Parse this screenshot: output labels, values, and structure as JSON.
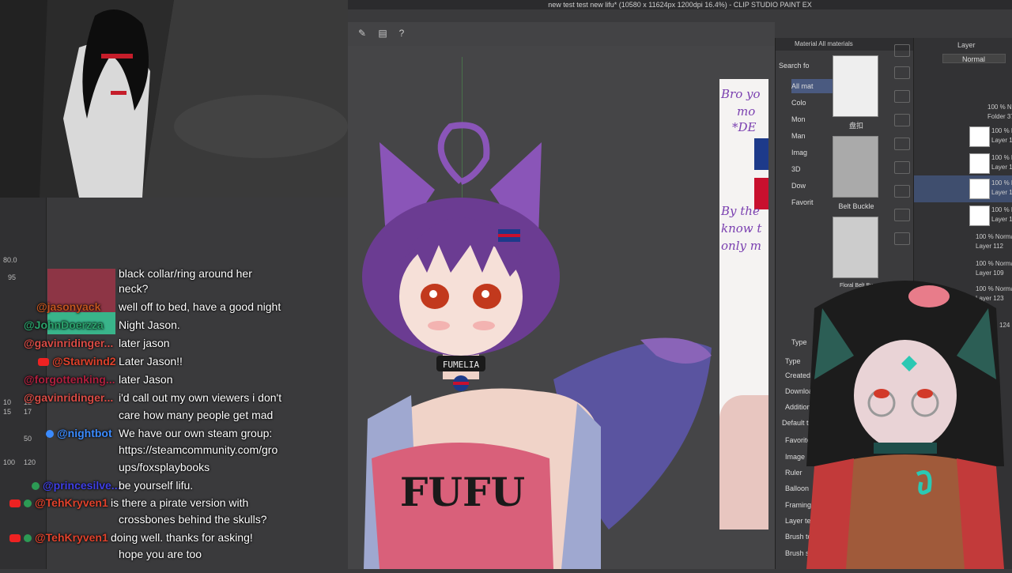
{
  "window": {
    "title": "new test test new lifu* (10580 x 11624px 1200dpi 16.4%) - CLIP STUDIO PAINT EX"
  },
  "left_panel": {
    "brush_size": "80.0",
    "opacity": "95",
    "size_presets": [
      "10",
      "12",
      "15",
      "17",
      "50",
      "100",
      "120"
    ]
  },
  "chat": {
    "messages": [
      {
        "user": "",
        "text": "black collar/ring around her",
        "user_color": "#ffffff"
      },
      {
        "user": "",
        "text": "neck?",
        "user_color": "#ffffff"
      },
      {
        "user": "@jasonyack",
        "text": "well off to bed, have a good night",
        "user_color": "#c2551f"
      },
      {
        "user": "@JohnDoerzza",
        "text": "Night Jason.",
        "user_color": "#2aa36b"
      },
      {
        "user": "@gavinridinger...",
        "text": "later jason",
        "user_color": "#d94b45"
      },
      {
        "user": "@Starwind2",
        "text": "Later Jason!!",
        "user_color": "#e0422c"
      },
      {
        "user": "@forgottenking...",
        "text": "later Jason",
        "user_color": "#b01f3e"
      },
      {
        "user": "@gavinridinger...",
        "text": "i'd call out my own viewers i don't",
        "user_color": "#d94b45"
      },
      {
        "user": "",
        "text": "care how many people get mad",
        "user_color": "#ffffff"
      },
      {
        "user": "@nightbot",
        "text": "We have our own steam group:",
        "user_color": "#3b8bff"
      },
      {
        "user": "",
        "text": "https://steamcommunity.com/gro",
        "user_color": "#ffffff"
      },
      {
        "user": "",
        "text": "ups/foxsplaybooks",
        "user_color": "#ffffff"
      },
      {
        "user": "@princesilve...",
        "text": "be yourself lifu.",
        "user_color": "#3f3fe6"
      },
      {
        "user": "@TehKryven1",
        "text": "is there a pirate version with",
        "user_color": "#e0422c"
      },
      {
        "user": "",
        "text": "crossbones behind the skulls?",
        "user_color": "#ffffff"
      },
      {
        "user": "@TehKryven1",
        "text": "doing well. thanks for asking!",
        "user_color": "#e0422c"
      },
      {
        "user": "",
        "text": "hope you are too",
        "user_color": "#ffffff"
      }
    ]
  },
  "materials": {
    "header": "Material  All materials",
    "search_label": "Search fo",
    "tree": [
      "All mat",
      "Colo",
      "Mon",
      "Man",
      "Imag",
      "3D",
      "Dow",
      "Favorit"
    ],
    "thumb_labels": [
      "盘扣",
      "Belt Buckle",
      "Floral Belt Bu"
    ],
    "type_search": "Type",
    "filters": [
      "Type",
      "Created ma",
      "Downloade",
      "Additional",
      "Default tag",
      "Favorites",
      "Image mat",
      "Ruler",
      "Balloon",
      "Framing ten",
      "Layer temp",
      "Brush tool",
      "Brush shap"
    ]
  },
  "layers": {
    "header": "Layer",
    "blend_mode": "Normal",
    "rows": [
      {
        "pct": "100 % Norma",
        "name": "Folder 37"
      },
      {
        "pct": "100 % No",
        "name": "Layer 11"
      },
      {
        "pct": "100 % No",
        "name": "Layer 13"
      },
      {
        "pct": "100 % No",
        "name": "Layer 11"
      },
      {
        "pct": "100 % No",
        "name": "Layer 11"
      },
      {
        "pct": "100 % Norma",
        "name": "Layer 112"
      },
      {
        "pct": "100 % Norma",
        "name": "Layer 109"
      },
      {
        "pct": "100 % Norma",
        "name": "Layer 123"
      },
      {
        "pct": "",
        "name": "124"
      }
    ]
  },
  "reference": {
    "lines": [
      "Bro yo",
      "mo",
      "*DE",
      "By the",
      "know t",
      "only m"
    ]
  },
  "avatar": {
    "collar_text": "FUMELIA",
    "shirt_text": "FUFU",
    "hair_color": "#6b3c92",
    "shirt_color": "#d9607a"
  }
}
